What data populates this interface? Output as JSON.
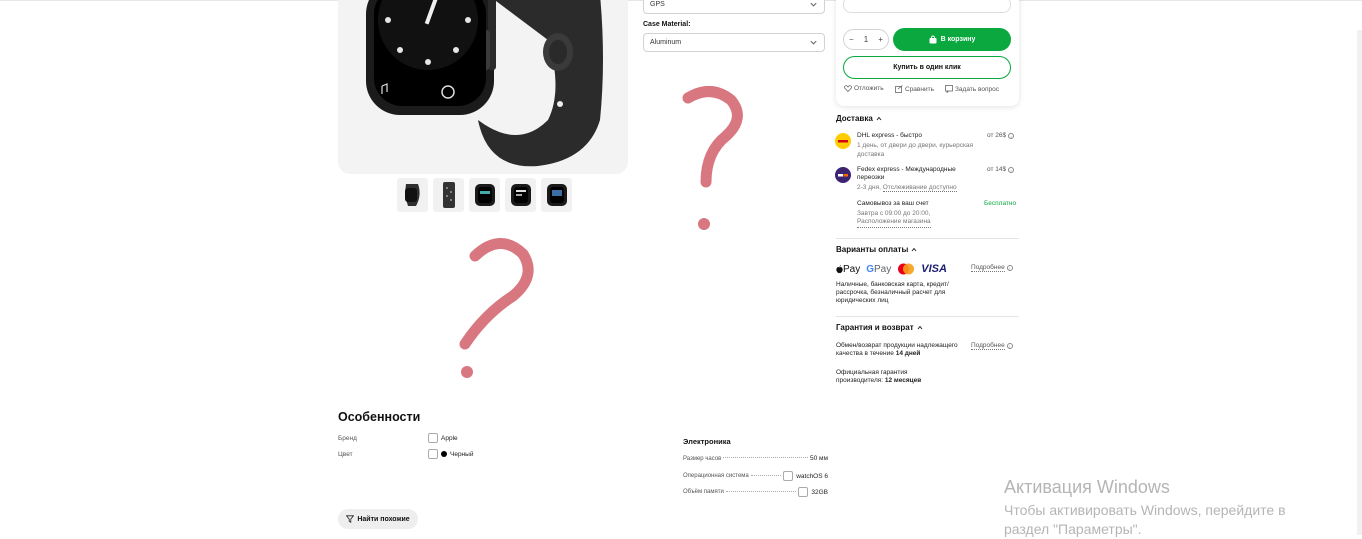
{
  "product": {
    "connectivity_value": "GPS",
    "case_material_label": "Case Material:",
    "case_material_value": "Aluminum",
    "thumb_count": 5
  },
  "buy": {
    "qty_minus": "−",
    "qty": "1",
    "qty_plus": "+",
    "cart_label": "В корзину",
    "one_click_label": "Купить в один клик",
    "defer_label": "Отложить",
    "compare_label": "Сравнить",
    "ask_label": "Задать вопрос"
  },
  "delivery": {
    "title": "Доставка",
    "dhl_name": "DHL express - быстро",
    "dhl_desc": "1 день, от двери до двери, курьерская доставка",
    "dhl_price": "от 26$",
    "fedex_name": "Fedex express - Международные переозки",
    "fedex_days": "2-3 дня,",
    "fedex_link": "Отслеживание доступно",
    "fedex_price": "от 14$",
    "pickup_name": "Самовывоз за ваш счет",
    "pickup_time": "Завтра с 09:00 до 20:00,",
    "pickup_link": "Расположение магазина",
    "pickup_price": "Бесплатно"
  },
  "payment": {
    "title": "Варианты оплаты",
    "apple_pay": "Pay",
    "google_pay": "Pay",
    "visa": "VISA",
    "more": "Подробнее",
    "desc": "Наличные, банковская карта, кредит/ рассрочка, безналичный расчет для юридических лиц"
  },
  "warranty": {
    "title": "Гарантия и возврат",
    "exchange_text": "Обмен/возврат продукции надлежащего качества в течение",
    "exchange_bold": "14 дней",
    "official_text": "Официальная гарантия производителя:",
    "official_bold": "12 месяцев",
    "more": "Подробнее"
  },
  "features": {
    "title": "Особенности",
    "brand_key": "Бренд",
    "brand_val": "Apple",
    "color_key": "Цвет",
    "color_val": "Черный",
    "electronics_title": "Электроника",
    "specs": [
      {
        "key": "Размер часов",
        "val": "50  мм"
      },
      {
        "key": "Операционная система",
        "val": "watchOS 6"
      },
      {
        "key": "Объём памяти",
        "val": "32GB"
      }
    ],
    "similar_btn": "Найти похожие"
  },
  "windows": {
    "title": "Активация Windows",
    "subtitle": "Чтобы активировать Windows, перейдите в раздел \"Параметры\"."
  },
  "colors": {
    "accent_green": "#0aa83f",
    "annotation_pink": "#d97780"
  }
}
